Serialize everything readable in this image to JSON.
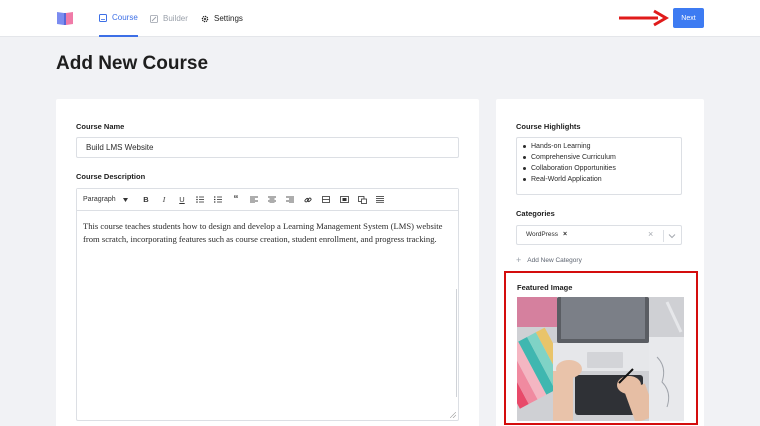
{
  "nav": {
    "tabs": [
      {
        "label": "Course",
        "icon": "book-icon",
        "active": true
      },
      {
        "label": "Builder",
        "icon": "edit-icon",
        "active": false
      },
      {
        "label": "Settings",
        "icon": "gear-icon",
        "active": false
      }
    ],
    "next_label": "Next",
    "accent": "#3d6fe6"
  },
  "page": {
    "title": "Add New Course"
  },
  "course": {
    "name_label": "Course Name",
    "name_value": "Build LMS Website",
    "description_label": "Course Description",
    "toolbar": {
      "format": "Paragraph",
      "buttons": [
        "B",
        "I",
        "U",
        "≡",
        "≡",
        "“",
        "≡",
        "≡",
        "≡",
        "⛓",
        "─",
        "▣",
        "▨",
        "≡"
      ]
    },
    "description_text": "This course teaches students how to design and develop a Learning Management System (LMS) website from scratch, incorporating features such as course creation, student enrollment, and progress tracking."
  },
  "sidebar": {
    "highlights_label": "Course Highlights",
    "highlights": [
      "Hands-on Learning",
      "Comprehensive Curriculum",
      "Collaboration Opportunities",
      "Real-World Application"
    ],
    "categories_label": "Categories",
    "category_chip": "WordPress",
    "category_chip_remove": "×",
    "clear_symbol": "×",
    "add_category_label": "Add New Category",
    "add_symbol": "+",
    "featured_label": "Featured Image"
  }
}
